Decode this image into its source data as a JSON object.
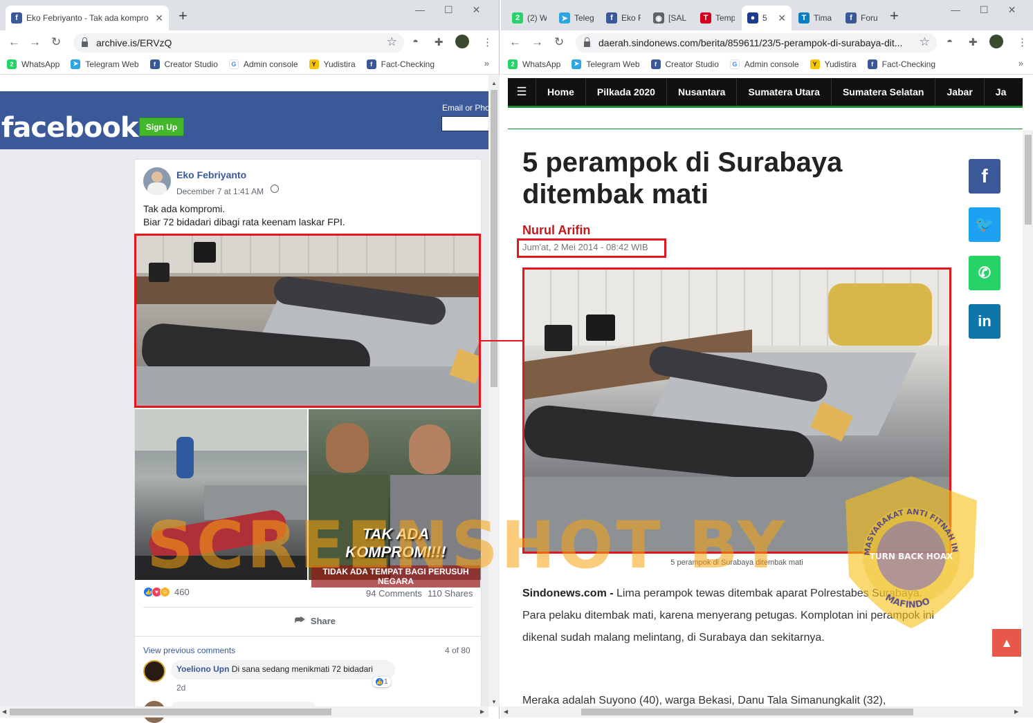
{
  "left_window": {
    "tab_title": "Eko Febriyanto - Tak ada kompro",
    "url": "archive.is/ERVzQ",
    "bookmarks": [
      {
        "label": "WhatsApp",
        "icon": "whatsapp-icon",
        "color": "#25d366",
        "glyph": "2"
      },
      {
        "label": "Telegram Web",
        "icon": "telegram-icon",
        "color": "#2ca5e0",
        "glyph": "➤"
      },
      {
        "label": "Creator Studio",
        "icon": "facebook-icon",
        "color": "#3b5998",
        "glyph": "f"
      },
      {
        "label": "Admin console",
        "icon": "google-icon",
        "color": "#ffffff",
        "glyph": "G"
      },
      {
        "label": "Yudistira",
        "icon": "yudistira-icon",
        "color": "#f5c400",
        "glyph": "Y"
      },
      {
        "label": "Fact-Checking",
        "icon": "facebook-icon",
        "color": "#3b5998",
        "glyph": "f"
      }
    ],
    "more_bookmarks": "»",
    "facebook": {
      "logo": "facebook",
      "signup": "Sign Up",
      "email_label": "Email or Pho",
      "post": {
        "author": "Eko Febriyanto",
        "date": "December 7 at 1:41 AM",
        "text_line1": "Tak ada kompromi.",
        "text_line2": "Biar 72 bidadari dibagi rata keenam laskar FPI.",
        "image_text_main": "TAK ADA KOMPROMI!!!",
        "image_text_sub": "TIDAK ADA TEMPAT BAGI PERUSUH NEGARA",
        "reaction_count": "460",
        "comments": "94 Comments",
        "shares": "110 Shares",
        "share_label": "Share",
        "view_previous": "View previous comments",
        "comment_page": "4 of 80",
        "comment": {
          "name": "Yoeliono Upn",
          "text": "Di sana sedang menikmati 72 bidadari",
          "age": "2d",
          "likes": "1"
        }
      }
    }
  },
  "right_window": {
    "tabs": [
      {
        "label": "(2) W",
        "icon": "whatsapp-icon",
        "color": "#25d366",
        "glyph": "2"
      },
      {
        "label": "Teleg",
        "icon": "telegram-icon",
        "color": "#2ca5e0",
        "glyph": "➤"
      },
      {
        "label": "Eko F",
        "icon": "facebook-icon",
        "color": "#3b5998",
        "glyph": "f"
      },
      {
        "label": "[SAL",
        "icon": "globe-icon",
        "color": "#5f6368",
        "glyph": "◉"
      },
      {
        "label": "Temp",
        "icon": "tempo-icon",
        "color": "#d6001c",
        "glyph": "T"
      },
      {
        "label": "5",
        "icon": "sindonews-icon",
        "color": "#1a3d8f",
        "glyph": "●"
      },
      {
        "label": "Tima",
        "icon": "timesindonesia-icon",
        "color": "#0a7cc1",
        "glyph": "T"
      },
      {
        "label": "Foru",
        "icon": "facebook-icon",
        "color": "#3b5998",
        "glyph": "f"
      }
    ],
    "url": "daerah.sindonews.com/berita/859611/23/5-perampok-di-surabaya-dit...",
    "bookmarks": [
      {
        "label": "WhatsApp",
        "icon": "whatsapp-icon",
        "color": "#25d366",
        "glyph": "2"
      },
      {
        "label": "Telegram Web",
        "icon": "telegram-icon",
        "color": "#2ca5e0",
        "glyph": "➤"
      },
      {
        "label": "Creator Studio",
        "icon": "facebook-icon",
        "color": "#3b5998",
        "glyph": "f"
      },
      {
        "label": "Admin console",
        "icon": "google-icon",
        "color": "#ffffff",
        "glyph": "G"
      },
      {
        "label": "Yudistira",
        "icon": "yudistira-icon",
        "color": "#f5c400",
        "glyph": "Y"
      },
      {
        "label": "Fact-Checking",
        "icon": "facebook-icon",
        "color": "#3b5998",
        "glyph": "f"
      }
    ],
    "more_bookmarks": "»",
    "site_nav": [
      "Home",
      "Pilkada 2020",
      "Nusantara",
      "Sumatera Utara",
      "Sumatera Selatan",
      "Jabar",
      "Ja"
    ],
    "article": {
      "title": "5 perampok di Surabaya ditembak mati",
      "writer": "Nurul Arifin",
      "date": "Jum'at, 2 Mei 2014 - 08:42 WIB",
      "caption": "5 perampok di Surabaya ditembak mati",
      "source": "Sindonews.com -",
      "body": "Lima perampok tewas ditembak aparat Polrestabes Surabaya. Para pelaku ditembak mati, karena menyerang petugas. Komplotan ini perampok ini dikenal sudah malang melintang, di Surabaya dan sekitarnya.",
      "body2": "Meraka adalah Suyono (40), warga Bekasi, Danu Tala Simanungkalit (32),"
    },
    "social": [
      {
        "label": "f",
        "icon": "facebook-share-icon",
        "color": "#3b5998"
      },
      {
        "label": "🐦",
        "icon": "twitter-share-icon",
        "color": "#1da1f2"
      },
      {
        "label": "✆",
        "icon": "whatsapp-share-icon",
        "color": "#25d366"
      },
      {
        "label": "in",
        "icon": "linkedin-share-icon",
        "color": "#0e76a8"
      }
    ],
    "back_to_top": "▲"
  },
  "overlay": {
    "watermark": "SCREENSHOT BY",
    "badge_top": "MASYARAKAT ANTI FITNAH INDONESIA",
    "badge_center": "TURN BACK HOAX",
    "badge_bottom": "MAFINDO"
  }
}
